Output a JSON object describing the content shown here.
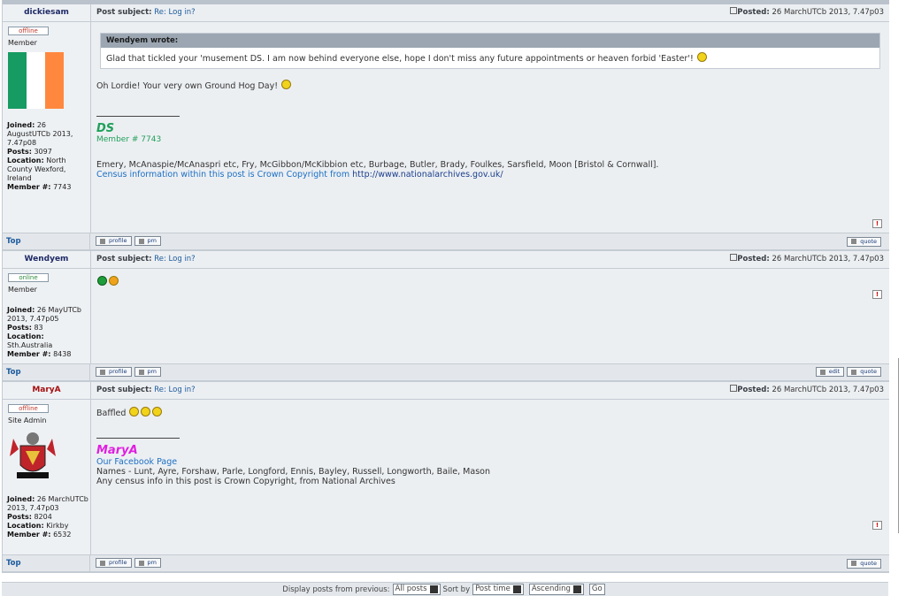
{
  "posts": [
    {
      "author": "dickiesam",
      "status": "offline",
      "rank": "Member",
      "joined_label": "Joined:",
      "joined": "26 AugustUTCb 2013, 7.47p08",
      "posts_label": "Posts:",
      "posts": "3097",
      "location_label": "Location:",
      "location": "North County Wexford, Ireland",
      "member_label": "Member #:",
      "member": "7743",
      "subject_label": "Post subject:",
      "subject": "Re: Log in?",
      "posted_label": "Posted:",
      "posted": "26 MarchUTCb 2013, 7.47p03",
      "quote_author": "Wendyem wrote:",
      "quote_text": "Glad that tickled your 'musement DS. I am now behind everyone else, hope I don't miss any future appointments or heaven forbid 'Easter'!",
      "body": "Oh Lordie! Your very own Ground Hog Day!",
      "sig_name": "DS",
      "sig_member": "Member # 7743",
      "sig_names": "Emery, McAnaspie/McAnaspri etc, Fry, McGibbon/McKibbion etc, Burbage, Butler, Brady, Foulkes, Sarsfield, Moon [Bristol & Cornwall].",
      "sig_census": "Census information within this post is Crown Copyright from",
      "sig_url": "http://www.nationalarchives.gov.uk/"
    },
    {
      "author": "Wendyem",
      "status": "online",
      "rank": "Member",
      "joined_label": "Joined:",
      "joined": "26 MayUTCb 2013, 7.47p05",
      "posts_label": "Posts:",
      "posts": "83",
      "location_label": "Location:",
      "location": "Sth.Australia",
      "member_label": "Member #:",
      "member": "8438",
      "subject_label": "Post subject:",
      "subject": "Re: Log in?",
      "posted_label": "Posted:",
      "posted": "26 MarchUTCb 2013, 7.47p03"
    },
    {
      "author": "MaryA",
      "status": "offline",
      "rank": "Site Admin",
      "joined_label": "Joined:",
      "joined": "26 MarchUTCb 2013, 7.47p03",
      "posts_label": "Posts:",
      "posts": "8204",
      "location_label": "Location:",
      "location": "Kirkby",
      "member_label": "Member #:",
      "member": "6532",
      "subject_label": "Post subject:",
      "subject": "Re: Log in?",
      "posted_label": "Posted:",
      "posted": "26 MarchUTCb 2013, 7.47p03",
      "body": "Baffled",
      "sig_name": "MaryA",
      "sig_link": "Our Facebook Page",
      "sig_names": "Names - Lunt, Ayre, Forshaw, Parle, Longford, Ennis, Bayley, Russell, Longworth, Baile, Mason",
      "sig_census": "Any census info in this post is Crown Copyright, from National Archives"
    }
  ],
  "buttons": {
    "top": "Top",
    "profile": "profile",
    "pm": "pm",
    "quote": "quote",
    "edit": "edit",
    "report": "!"
  },
  "bottom": {
    "display_label": "Display posts from previous:",
    "display_value": "All posts",
    "sort_label": "Sort by",
    "sort_value": "Post time",
    "order_value": "Ascending",
    "go": "Go"
  },
  "colors": {
    "ds_signature": "#1fa05a",
    "marya_signature": "#e01ee0",
    "link": "#1c6fc4"
  }
}
